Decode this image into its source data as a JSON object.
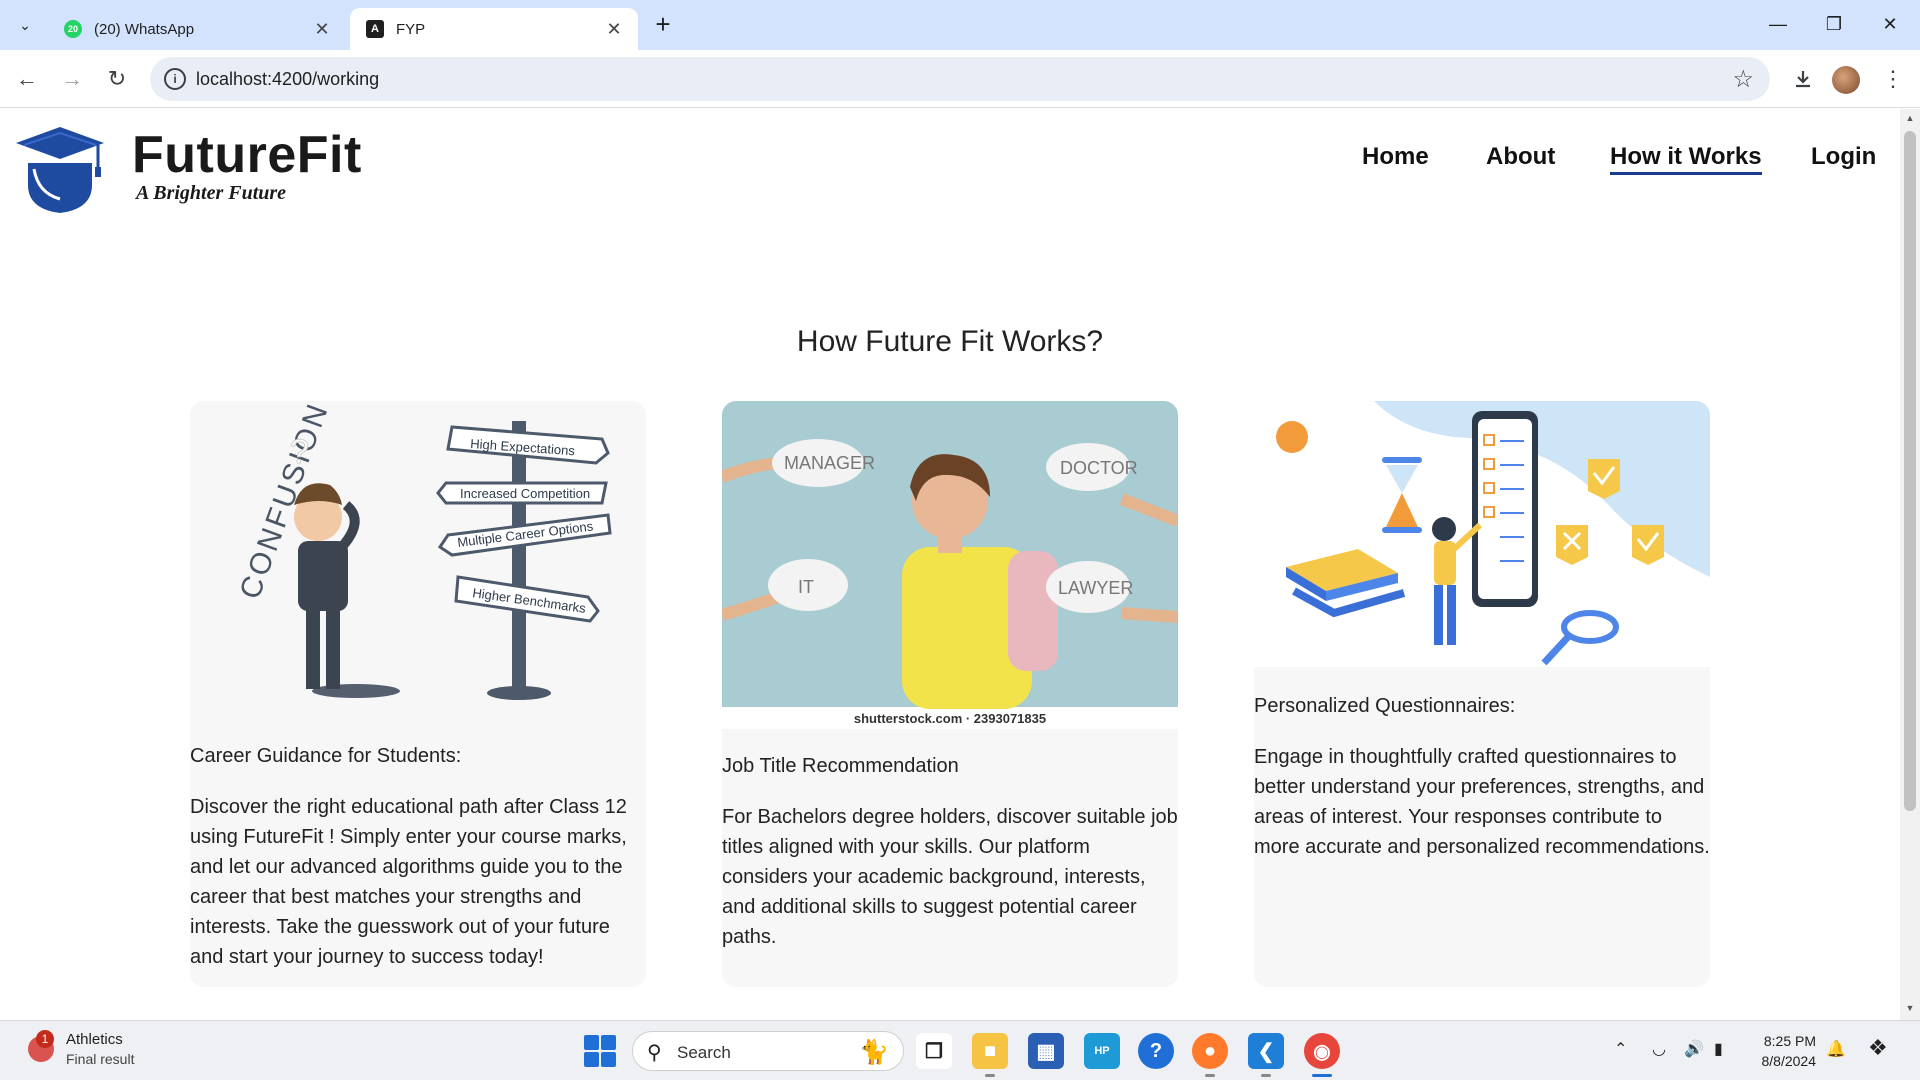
{
  "browser": {
    "tabs": [
      {
        "title": "(20) WhatsApp",
        "favicon_text": "20",
        "favicon": "whatsapp-icon"
      },
      {
        "title": "FYP",
        "favicon_text": "A",
        "favicon": "angular-icon"
      }
    ],
    "address": "localhost:4200/working"
  },
  "site": {
    "brand": "FutureFit",
    "tagline": "A Brighter Future",
    "colors": {
      "brand_blue": "#1a3a8f",
      "card_bg": "#f7f7f7"
    },
    "nav": [
      {
        "label": "Home"
      },
      {
        "label": "About"
      },
      {
        "label": "How it Works",
        "active": true
      },
      {
        "label": "Login"
      }
    ]
  },
  "main": {
    "heading": "How Future Fit Works?",
    "cards": [
      {
        "title": "Career Guidance for Students:",
        "text": "Discover the right educational path after Class 12 using FutureFit ! Simply enter your course marks, and let our advanced algorithms guide you to the career that best matches your strengths and interests. Take the guesswork out of your future and start your journey to success today!",
        "image": {
          "signs": [
            "High Expectations",
            "Increased Competition",
            "Multiple Career Options",
            "Higher Benchmarks"
          ],
          "word": "CONFUSION"
        }
      },
      {
        "title": "Job Title Recommendation",
        "text": "For Bachelors degree holders, discover suitable job titles aligned with your skills. Our platform considers your academic background, interests, and additional skills to suggest potential career paths.",
        "image": {
          "bubbles": [
            "MANAGER",
            "DOCTOR",
            "IT",
            "LAWYER"
          ],
          "credit": "shutterstock.com · 2393071835"
        }
      },
      {
        "title": "Personalized Questionnaires:",
        "text": "Engage in thoughtfully crafted questionnaires to better understand your preferences, strengths, and areas of interest. Your responses contribute to more accurate and personalized recommendations."
      }
    ]
  },
  "taskbar": {
    "widget": {
      "title": "Athletics",
      "subtitle": "Final result",
      "badge": "1"
    },
    "search_label": "Search",
    "time": "8:25 PM",
    "date": "8/8/2024"
  }
}
